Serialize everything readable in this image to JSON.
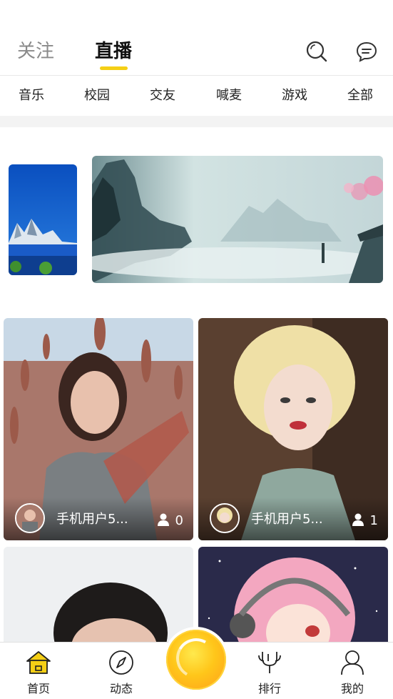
{
  "header": {
    "tabs": [
      {
        "label": "关注",
        "active": false
      },
      {
        "label": "直播",
        "active": true
      }
    ],
    "icons": [
      "search-icon",
      "message-icon"
    ],
    "accent": "#f5cf15"
  },
  "categories": [
    "音乐",
    "校园",
    "交友",
    "喊麦",
    "游戏",
    "全部"
  ],
  "banners": [
    {
      "icon": "mountain-lake-image"
    },
    {
      "icon": "misty-landscape-painting"
    }
  ],
  "cards": [
    {
      "name": "手机用户5...",
      "viewers": "0"
    },
    {
      "name": "手机用户5...",
      "viewers": "1"
    },
    {
      "name": "",
      "viewers": ""
    },
    {
      "name": "",
      "viewers": ""
    }
  ],
  "bottom_nav": [
    {
      "label": "首页",
      "icon": "home-icon",
      "active": true
    },
    {
      "label": "动态",
      "icon": "compass-icon",
      "active": false
    },
    {
      "label": "",
      "icon": "live-start-button",
      "active": false
    },
    {
      "label": "排行",
      "icon": "trophy-icon",
      "active": false
    },
    {
      "label": "我的",
      "icon": "user-icon",
      "active": false
    }
  ]
}
